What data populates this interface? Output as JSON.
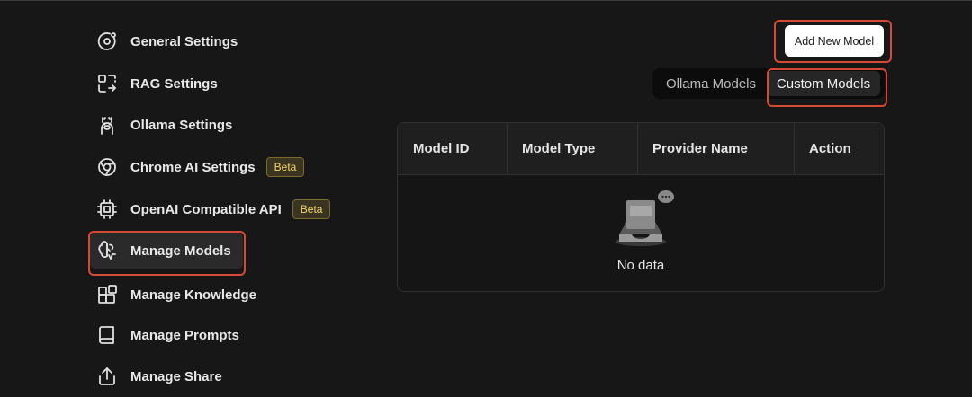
{
  "sidebar": {
    "items": [
      {
        "label": "General Settings",
        "icon": "orbit-icon"
      },
      {
        "label": "RAG Settings",
        "icon": "scan-icon"
      },
      {
        "label": "Ollama Settings",
        "icon": "llama-icon"
      },
      {
        "label": "Chrome AI Settings",
        "icon": "chrome-icon",
        "badge": "Beta"
      },
      {
        "label": "OpenAI Compatible API",
        "icon": "cpu-icon",
        "badge": "Beta"
      },
      {
        "label": "Manage Models",
        "icon": "brain-icon",
        "active": true
      },
      {
        "label": "Manage Knowledge",
        "icon": "blocks-icon"
      },
      {
        "label": "Manage Prompts",
        "icon": "book-icon"
      },
      {
        "label": "Manage Share",
        "icon": "share-icon"
      }
    ]
  },
  "toolbar": {
    "add_button_label": "Add New Model"
  },
  "tabs": {
    "ollama_label": "Ollama Models",
    "custom_label": "Custom Models",
    "selected": "Custom Models"
  },
  "table": {
    "columns": [
      "Model ID",
      "Model Type",
      "Provider Name",
      "Action"
    ],
    "empty_text": "No data"
  },
  "colors": {
    "background": "#171717",
    "highlight": "#d64a35",
    "badge_text": "#f5d76e"
  }
}
